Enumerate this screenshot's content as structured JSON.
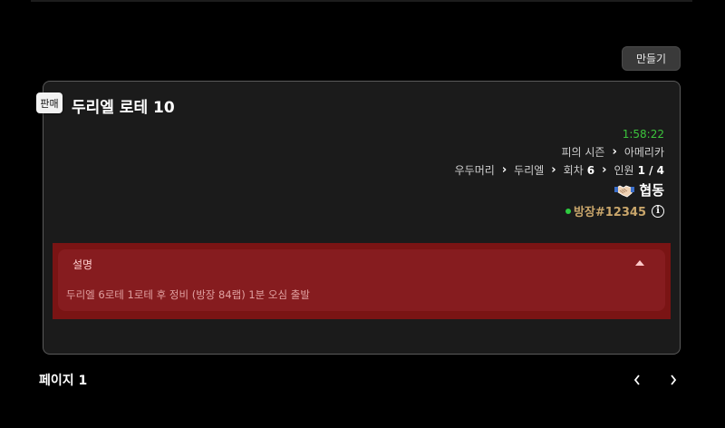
{
  "toolbar": {
    "create_label": "만들기"
  },
  "listing": {
    "badge": "판매",
    "title": "두리엘 로테 10",
    "timer": "1:58:22",
    "season": "피의 시즌",
    "region": "아메리카",
    "difficulty": "우두머리",
    "boss": "두리엘",
    "runs_label": "회차",
    "runs_value": "6",
    "members_label": "인원",
    "members_value": "1 / 4",
    "mode_icon": "handshake-icon",
    "mode": "협동",
    "host": "방장#12345",
    "host_status_color": "#2ecc40",
    "description_label": "설명",
    "description": "두리엘 6로테 1로테 후 정비 (방장 84랩) 1분 오심 출발"
  },
  "pagination": {
    "label": "페이지 1"
  },
  "colors": {
    "background": "#000000",
    "card": "#1b1b1b",
    "description_panel": "#861c1f",
    "timer": "#3cc43c",
    "host": "#c9a66b"
  }
}
